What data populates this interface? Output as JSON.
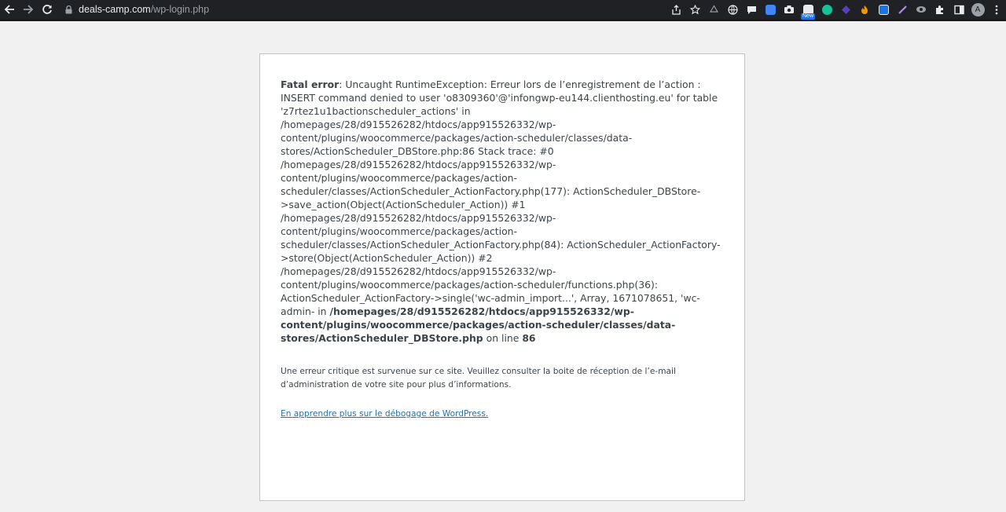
{
  "browser": {
    "url_host": "deals-camp.com",
    "url_path": "/wp-login.php",
    "new_badge": "New",
    "profile_initial": "A",
    "toolbar_icons": [
      "share-icon",
      "star-icon",
      "recycle-icon",
      "globe-icon",
      "chat-icon",
      "translate-icon",
      "camera-icon",
      "new-extension-icon",
      "grammarly-icon",
      "diamond-icon",
      "flame-icon",
      "screenshot-icon",
      "pen-icon",
      "eye-extension-icon",
      "puzzle-icon",
      "sidebar-icon"
    ]
  },
  "error": {
    "label": "Fatal error",
    "message": ": Uncaught RuntimeException: Erreur lors de l’enregistrement de l’action : INSERT command denied to user 'o8309360'@'infongwp-eu144.clienthosting.eu' for table 'z7rtez1u1bactionscheduler_actions' in /homepages/28/d915526282/htdocs/app915526332/wp-content/plugins/woocommerce/packages/action-scheduler/classes/data-stores/ActionScheduler_DBStore.php:86 Stack trace: #0 /homepages/28/d915526282/htdocs/app915526332/wp-content/plugins/woocommerce/packages/action-scheduler/classes/ActionScheduler_ActionFactory.php(177): ActionScheduler_DBStore->save_action(Object(ActionScheduler_Action)) #1 /homepages/28/d915526282/htdocs/app915526332/wp-content/plugins/woocommerce/packages/action-scheduler/classes/ActionScheduler_ActionFactory.php(84): ActionScheduler_ActionFactory->store(Object(ActionScheduler_Action)) #2 /homepages/28/d915526282/htdocs/app915526332/wp-content/plugins/woocommerce/packages/action-scheduler/functions.php(36): ActionScheduler_ActionFactory->single('wc-admin_import...', Array, 1671078651, 'wc-admin- in ",
    "file": "/homepages/28/d915526282/htdocs/app915526332/wp-content/plugins/woocommerce/packages/action-scheduler/classes/data-stores/ActionScheduler_DBStore.php",
    "on_line": " on line ",
    "line": "86"
  },
  "notice": "Une erreur critique est survenue sur ce site. Veuillez consulter la boite de réception de l’e-mail d’administration de votre site pour plus d’informations.",
  "learn_more_link": "En apprendre plus sur le débogage de WordPress.",
  "colors": {
    "chrome_bg": "#202124",
    "page_bg": "#f1f1f1",
    "box_border": "#c3c4c7",
    "link": "#2271b1",
    "text": "#3c434a"
  }
}
